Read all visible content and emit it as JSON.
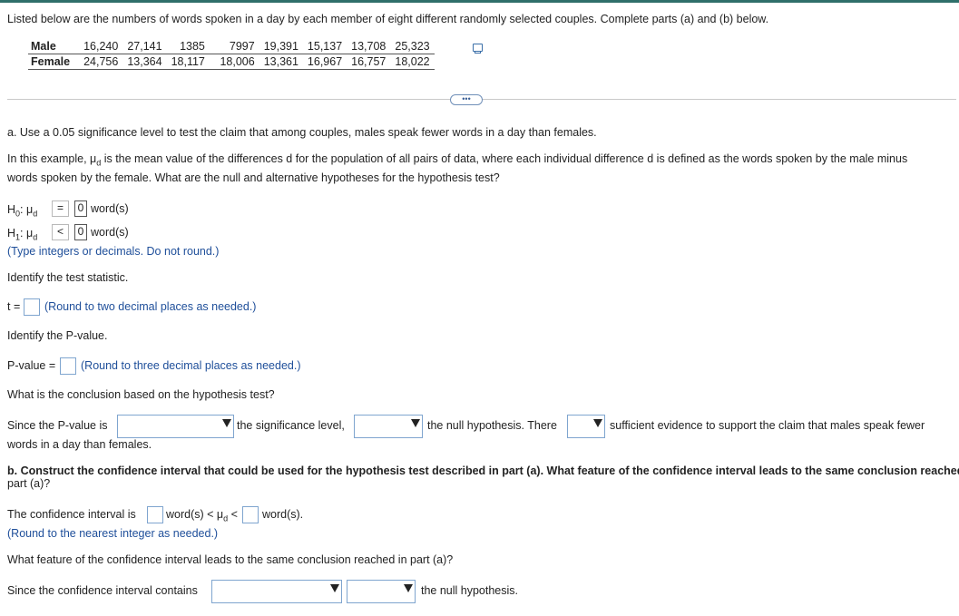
{
  "intro": "Listed below are the numbers of words spoken in a day by each member of eight different randomly selected couples. Complete parts (a) and (b) below.",
  "table": {
    "rows": [
      {
        "label": "Male",
        "values": [
          "16,240",
          "27,141",
          "1385",
          "7997",
          "19,391",
          "15,137",
          "13,708",
          "25,323"
        ]
      },
      {
        "label": "Female",
        "values": [
          "24,756",
          "13,364",
          "18,117",
          "18,006",
          "13,361",
          "16,967",
          "16,757",
          "18,022"
        ]
      }
    ]
  },
  "more_button": "•••",
  "part_a": {
    "prompt": "a. Use a 0.05 significance level to test the claim that among couples, males speak fewer words in a day than females.",
    "example_line1_a": "In this example, μ",
    "example_line1_sub": "d",
    "example_line1_b": " is the mean value of the differences d for the population of all pairs of data, where each individual difference d is defined as the words spoken by the male minus",
    "example_line2": "words spoken by the female. What are the null and alternative hypotheses for the hypothesis test?",
    "h0_prefix": "H",
    "h0_sub": "0",
    "h1_sub": "1",
    "mu": ": μ",
    "mu_sub": "d",
    "h0_operator": "=",
    "h0_value": "0",
    "h1_operator": "<",
    "h1_value": "0",
    "unit": "word(s)",
    "hyp_hint": "(Type integers or decimals. Do not round.)",
    "identify_stat": "Identify the test statistic.",
    "t_label": "t =",
    "t_hint": "(Round to two decimal places as needed.)",
    "identify_p": "Identify the P-value.",
    "p_label": "P-value =",
    "p_hint": "(Round to three decimal places as needed.)",
    "conclusion_q": "What is the conclusion based on the hypothesis test?",
    "since_p": "Since the P-value is",
    "sig_level": "the significance level,",
    "null_there": "the null hypothesis. There",
    "sufficient": "sufficient evidence to support the claim that males speak fewer",
    "words_day": "words in a day than females."
  },
  "part_b": {
    "prompt_line1": "b. Construct the confidence interval that could be used for the hypothesis test described in part (a). What feature of the confidence interval leads to the same conclusion reached in",
    "prompt_line2": "part (a)?",
    "ci_label": "The confidence interval is",
    "ci_mid_a": "word(s) < μ",
    "ci_mid_sub": "d",
    "ci_mid_b": " <",
    "ci_end": "word(s).",
    "ci_hint": "(Round to the nearest integer as needed.)",
    "feature_q": "What feature of the confidence interval leads to the same conclusion reached in part (a)?",
    "since_ci": "Since the confidence interval contains",
    "null_end": "the null hypothesis."
  }
}
